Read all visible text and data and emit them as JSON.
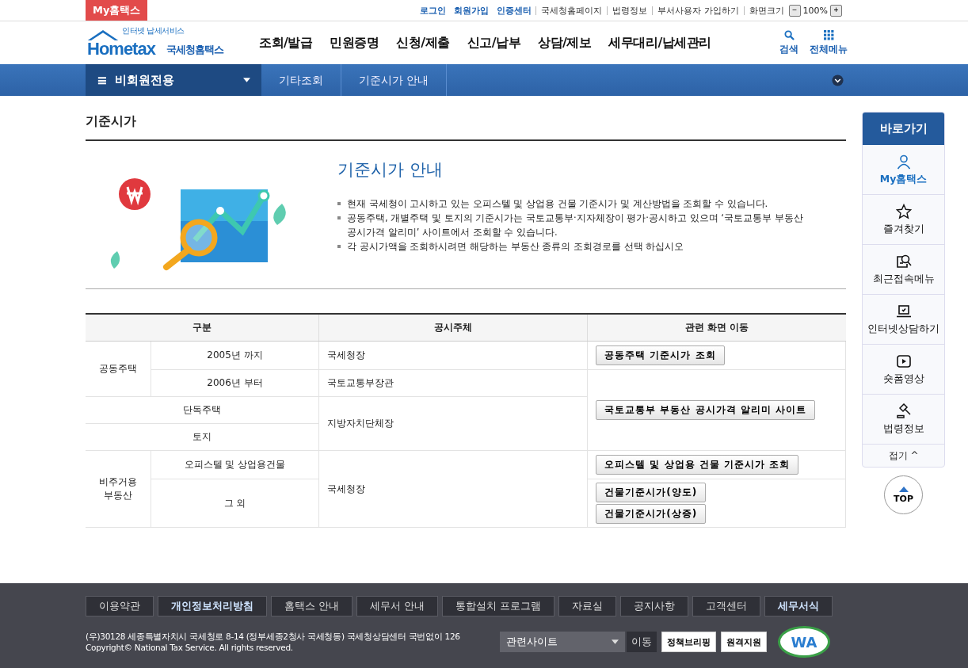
{
  "top_bar": {
    "my_tab": "My홈택스",
    "links": [
      {
        "label": "로그인",
        "kind": "primary"
      },
      {
        "label": "회원가입",
        "kind": "primary"
      },
      {
        "label": "인증센터",
        "kind": "primary"
      },
      {
        "label": "국세청홈페이지",
        "kind": "plain"
      },
      {
        "label": "법령정보",
        "kind": "plain"
      },
      {
        "label": "부서사용자 가입하기",
        "kind": "plain"
      }
    ],
    "zoom": {
      "label": "화면크기",
      "minus": "−",
      "value": "100%",
      "plus": "+"
    }
  },
  "header": {
    "logo": {
      "word": "Hometax",
      "tagline": "인터넷 납세서비스",
      "name": "국세청홈택스"
    },
    "menu": [
      "조회/발급",
      "민원증명",
      "신청/제출",
      "신고/납부",
      "상담/제보",
      "세무대리/납세관리"
    ],
    "tools": [
      {
        "label": "검색",
        "kind": "search"
      },
      {
        "label": "전체메뉴",
        "kind": "grid"
      }
    ]
  },
  "breadcrumb": {
    "menu_icon": "≡",
    "section": "비회원전용",
    "path": [
      "기타조회",
      "기준시가 안내"
    ]
  },
  "page_title": "기준시가",
  "intro": {
    "title": "기준시가 안내",
    "bullets": [
      "현재 국세청이 고시하고 있는 오피스텔 및 상업용 건물 기준시가 및 계산방법을 조회할 수 있습니다.",
      "공동주택, 개별주택 및 토지의 기준시가는 국토교통부·지자체장이 평가·공시하고 있으며 ‘국토교통부 부동산 공시가격 알리미’ 사이트에서 조회할 수 있습니다.",
      "각 공시가액을 조회하시려면 해당하는 부동산 종류의 조회경로를 선택 하십시오"
    ]
  },
  "table": {
    "columns": [
      {
        "label": "구분",
        "colspan": 2
      },
      {
        "label": "공시주체"
      },
      {
        "label": "관련 화면 이동"
      }
    ],
    "rows": [
      {
        "cells": [
          {
            "kind": "category",
            "text": "공동주택",
            "rowspan": 2
          },
          {
            "kind": "category",
            "text": "2005년 까지"
          },
          {
            "kind": "authority",
            "text": "국세청장"
          },
          {
            "kind": "links",
            "buttons": [
              "공동주택 기준시가 조회"
            ]
          }
        ]
      },
      {
        "cells": [
          {
            "kind": "category",
            "text": "2006년 부터"
          },
          {
            "kind": "authority",
            "text": "국토교통부장관"
          },
          {
            "kind": "links",
            "buttons": [
              "국토교통부 부동산 공시가격 알리미 사이트"
            ],
            "rowspan": 3
          }
        ]
      },
      {
        "cells": [
          {
            "kind": "category",
            "text": "단독주택",
            "colspan": 2
          },
          {
            "kind": "authority",
            "text": "지방자치단체장",
            "rowspan": 2
          }
        ]
      },
      {
        "cells": [
          {
            "kind": "category",
            "text": "토지",
            "colspan": 2
          }
        ]
      },
      {
        "cells": [
          {
            "kind": "category",
            "text": "비주거용\n부동산",
            "rowspan": 2
          },
          {
            "kind": "category",
            "text": "오피스텔 및 상업용건물"
          },
          {
            "kind": "authority",
            "text": "국세청장",
            "rowspan": 2
          },
          {
            "kind": "links",
            "buttons": [
              "오피스텔 및 상업용 건물 기준시가 조회"
            ]
          }
        ]
      },
      {
        "cells": [
          {
            "kind": "category",
            "text": "그 외"
          },
          {
            "kind": "links",
            "buttons": [
              "건물기준시가(양도)",
              "건물기준시가(상증)"
            ]
          }
        ]
      }
    ]
  },
  "quick_menu": {
    "title": "바로가기",
    "items": [
      {
        "label": "My홈택스",
        "kind": "user",
        "selected": true
      },
      {
        "label": "즐겨찾기",
        "kind": "star",
        "selected": false
      },
      {
        "label": "최근접속메뉴",
        "kind": "recent",
        "selected": false
      },
      {
        "label": "인터넷상담하기",
        "kind": "laptop",
        "selected": false
      },
      {
        "label": "숏폼영상",
        "kind": "play",
        "selected": false
      },
      {
        "label": "법령정보",
        "kind": "gavel",
        "selected": false
      }
    ],
    "collapse": "접기 ^",
    "top": "TOP"
  },
  "footer": {
    "links": [
      {
        "label": "이용약관",
        "bold": false
      },
      {
        "label": "개인정보처리방침",
        "bold": true
      },
      {
        "label": "홈택스 안내",
        "bold": false
      },
      {
        "label": "세무서 안내",
        "bold": false
      },
      {
        "label": "통합설치 프로그램",
        "bold": false
      },
      {
        "label": "자료실",
        "bold": false
      },
      {
        "label": "공지사항",
        "bold": false
      },
      {
        "label": "고객센터",
        "bold": false
      },
      {
        "label": "세무서식",
        "bold": true
      }
    ],
    "address": "(우)30128 세종특별자치시 국세청로 8-14 (정부세종2청사 국세청동) 국세청상담센터 국번없이 126",
    "copyright": "Copyright© National Tax Service. All rights reserved.",
    "site_select": "관련사이트",
    "go": "이동",
    "badges": [
      "정책브리핑",
      "원격지원"
    ],
    "wa_mark": "WA"
  }
}
